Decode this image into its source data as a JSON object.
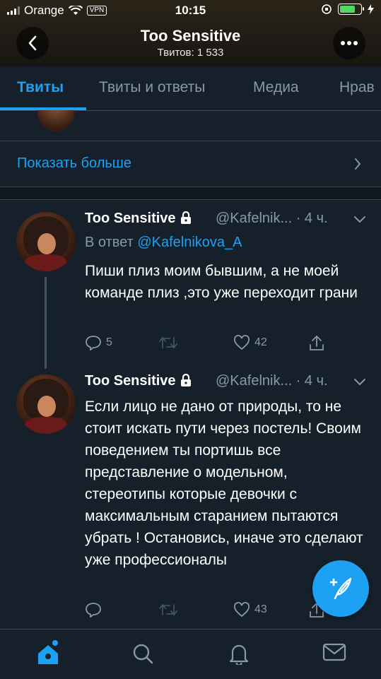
{
  "status_bar": {
    "carrier": "Orange",
    "vpn": "VPN",
    "time": "10:15"
  },
  "header": {
    "title": "Too Sensitive",
    "subtitle": "Твитов: 1 533"
  },
  "tabs": [
    {
      "label": "Твиты",
      "active": true
    },
    {
      "label": "Твиты и ответы",
      "active": false
    },
    {
      "label": "Медиа",
      "active": false
    },
    {
      "label": "Нрав",
      "active": false
    }
  ],
  "show_more": "Показать больше",
  "tweets": [
    {
      "name": "Too Sensitive",
      "handle": "@Kafelnik...",
      "time": "· 4 ч.",
      "reply_prefix": "В ответ",
      "reply_to": "@Kafelnikova_A",
      "text": "Пиши плиз моим бывшим, а не моей команде плиз ,это уже переходит грани",
      "replies": "5",
      "retweets": "",
      "likes": "42"
    },
    {
      "name": "Too Sensitive",
      "handle": "@Kafelnik...",
      "time": "· 4 ч.",
      "text": "Если лицо не дано от природы, то не стоит искать пути через постель! Своим поведением ты портишь все представление о модельном, стереотипы которые девочки с максимальным старанием пытаются убрать ! Остановись, иначе это сделают уже профессионалы",
      "replies": "",
      "retweets": "",
      "likes": "43"
    }
  ],
  "colors": {
    "background": "#15202b",
    "accent": "#1da1f2",
    "secondary_text": "#8899a6",
    "divider": "#38444d"
  },
  "icons": {
    "back": "chevron-left-icon",
    "more": "more-dots-icon",
    "lock": "lock-icon",
    "compose": "compose-tweet-icon",
    "nav": [
      "home-icon",
      "search-icon",
      "notifications-icon",
      "messages-icon"
    ]
  }
}
